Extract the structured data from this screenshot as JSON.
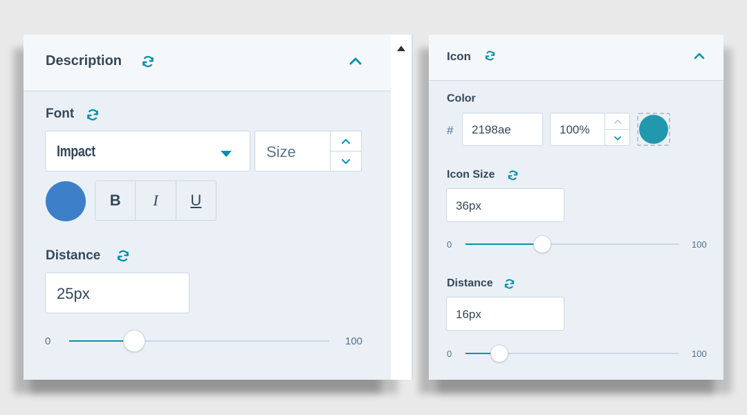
{
  "colors": {
    "accent": "#0091ae",
    "font_color_swatch": "#3d7fc9",
    "icon_color_swatch": "#2198ae"
  },
  "left": {
    "header": {
      "title": "Description"
    },
    "font": {
      "label": "Font",
      "family": "Impact",
      "size_placeholder": "Size",
      "bold_label": "B",
      "italic_label": "I",
      "underline_label": "U"
    },
    "distance": {
      "label": "Distance",
      "value": "25px",
      "min_label": "0",
      "max_label": "100",
      "level": 25
    }
  },
  "right": {
    "header": {
      "title": "Icon"
    },
    "color": {
      "label": "Color",
      "hash": "#",
      "hex": "2198ae",
      "opacity": "100%"
    },
    "icon_size": {
      "label": "Icon Size",
      "value": "36px",
      "min_label": "0",
      "max_label": "100",
      "level": 36
    },
    "distance": {
      "label": "Distance",
      "value": "16px",
      "min_label": "0",
      "max_label": "100",
      "level": 16
    }
  }
}
